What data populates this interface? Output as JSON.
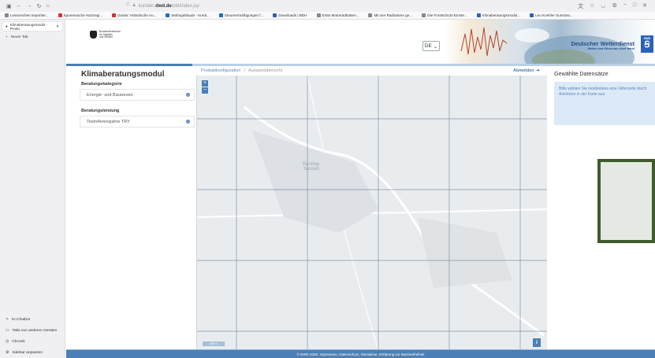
{
  "browser": {
    "url_prefix": "kunden.",
    "url_domain": "dwd.de",
    "url_path": "/okt/index.jsp",
    "bookmarks": [
      {
        "label": "Lesezeichen importier...",
        "color": "#888888"
      },
      {
        "label": "Spurensuche Harzregi...",
        "color": "#d9302c"
      },
      {
        "label": "Goslar: Historische Au...",
        "color": "#d9302c"
      },
      {
        "label": "Wohngebäude - Kredi...",
        "color": "#1f6fbf"
      },
      {
        "label": "Steuerermäßigungen f...",
        "color": "#1f6fbf"
      },
      {
        "label": "Downloads | BDH",
        "color": "#2a62b8"
      },
      {
        "label": "Erste Motorradbatteri...",
        "color": "#888888"
      },
      {
        "label": "Mit vier Radiatoren ge...",
        "color": "#888888"
      },
      {
        "label": "Die Frostschutz-Ernste...",
        "color": "#888888"
      },
      {
        "label": "Klimaberatungsmodul...",
        "color": "#2a62b8"
      },
      {
        "label": "Leo Koehler Sunstow...",
        "color": "#2a62b8"
      }
    ],
    "tab_title": "Klimaberatungsmodul - Produ",
    "new_tab_label": "Never Tab",
    "sidebar_links": [
      {
        "icon": "chatbot-icon",
        "label": "KI-Chatbot"
      },
      {
        "icon": "devices-icon",
        "label": "Tabs von anderen Geräten"
      },
      {
        "icon": "history-icon",
        "label": "Chronik"
      },
      {
        "icon": "settings-icon",
        "label": "Sidebar anpassen"
      }
    ]
  },
  "header": {
    "ministry_line1": "Bundesministerium",
    "ministry_line2": "für Digitales",
    "ministry_line3": "und Verkehr",
    "language": "DE",
    "dwd_title": "Deutscher Wetterdienst",
    "dwd_subtitle": "Wetter und Klima aus einer Hand",
    "dwd_logo_text": "DWD"
  },
  "left_panel": {
    "title": "Klimaberatungsmodul",
    "category_label": "Beratungskategorie",
    "category_value": "Energie- und Bauwesen",
    "service_label": "Beratungsleistung",
    "service_value": "Testreferenzjahre TRY"
  },
  "breadcrumb": {
    "link": "Produktkonfiguration",
    "separator": "/",
    "current": "Auswahlübersicht"
  },
  "logout_label": "Abmelden",
  "map": {
    "zoom_in": "+",
    "zoom_out": "−",
    "town_line1": "Barsing-",
    "town_line2": "hausen",
    "scale_label": "500 m",
    "info_label": "i"
  },
  "right_panel": {
    "title": "Gewählte Datensätze",
    "hint": "Bitte wählen Sie mindestens eine Gitterzelle durch Anklicken in der Karte aus.",
    "selection_color": "#3f5a2c"
  },
  "footer": {
    "text": "© DWD 2025, Impressum, Datenschutz, Disclaimer, Erklärung zur Barrierefreiheit"
  }
}
